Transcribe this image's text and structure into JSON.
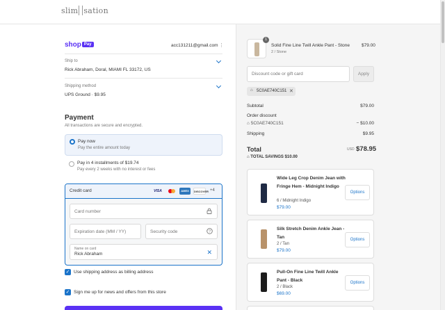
{
  "brand": {
    "logo_left": "slim",
    "logo_right": "sation"
  },
  "account": {
    "shop_label": "shop",
    "pay_label": "Pay",
    "email": "acc131211@gmail.com"
  },
  "ship_to": {
    "label": "Ship to",
    "value": "Rick Abraham, Doral, MIAMI FL 33172, US"
  },
  "shipping_method": {
    "label": "Shipping method",
    "value": "UPS Ground · $9.95"
  },
  "payment": {
    "title": "Payment",
    "subtitle": "All transactions are secure and encrypted.",
    "options": [
      {
        "title": "Pay now",
        "sub": "Pay the entire amount today",
        "selected": true
      },
      {
        "title": "Pay in 4 installments of $19.74",
        "sub": "Pay every 2 weeks with no interest or fees",
        "selected": false
      }
    ],
    "credit_card": {
      "label": "Credit card",
      "brands": [
        "VISA",
        "Mastercard",
        "AMEX",
        "DISCOVER"
      ],
      "more_brands": "+4",
      "card_number_placeholder": "Card number",
      "expiry_placeholder": "Expiration date (MM / YY)",
      "security_placeholder": "Security code",
      "name_label": "Name on card",
      "name_value": "Rick Abraham"
    },
    "use_shipping_as_billing": "Use shipping address as billing address",
    "newsletter": "Sign me up for news and offers from this store"
  },
  "order": {
    "item": {
      "name": "Solid Fine Line Twill Ankle Pant - Stone",
      "variant": "2 / Stone",
      "price": "$79.00",
      "qty": "1"
    },
    "discount_placeholder": "Discount code or gift card",
    "apply_label": "Apply",
    "code": "5C0AE740C151",
    "subtotal_label": "Subtotal",
    "subtotal": "$79.00",
    "order_discount_label": "Order discount",
    "discount_code": "5C0AE740C151",
    "discount_value": "− $10.00",
    "shipping_label": "Shipping",
    "shipping": "$9.95",
    "total_label": "Total",
    "currency": "USD",
    "total": "$78.95",
    "savings": "TOTAL SAVINGS  $10.00"
  },
  "upsell": [
    {
      "name": "Wide Leg Crop Denim Jean with Fringe Hem - Midnight Indigo",
      "variant": "6 / Midnight Indigo",
      "price": "$79.00",
      "button": "Options",
      "color": "#1f2a44"
    },
    {
      "name": "Silk Stretch Denim Ankle Jean - Tan",
      "variant": "2 / Tan",
      "price": "$79.00",
      "button": "Options",
      "color": "#b8926a"
    },
    {
      "name": "Pull-On Fine Line Twill Ankle Pant - Black",
      "variant": "2 / Black",
      "price": "$69.00",
      "button": "Options",
      "color": "#1c1c1c"
    }
  ],
  "colors": {
    "accent": "#1a73c9",
    "shop_purple": "#5a31f4",
    "stone": "#c9b79e"
  }
}
